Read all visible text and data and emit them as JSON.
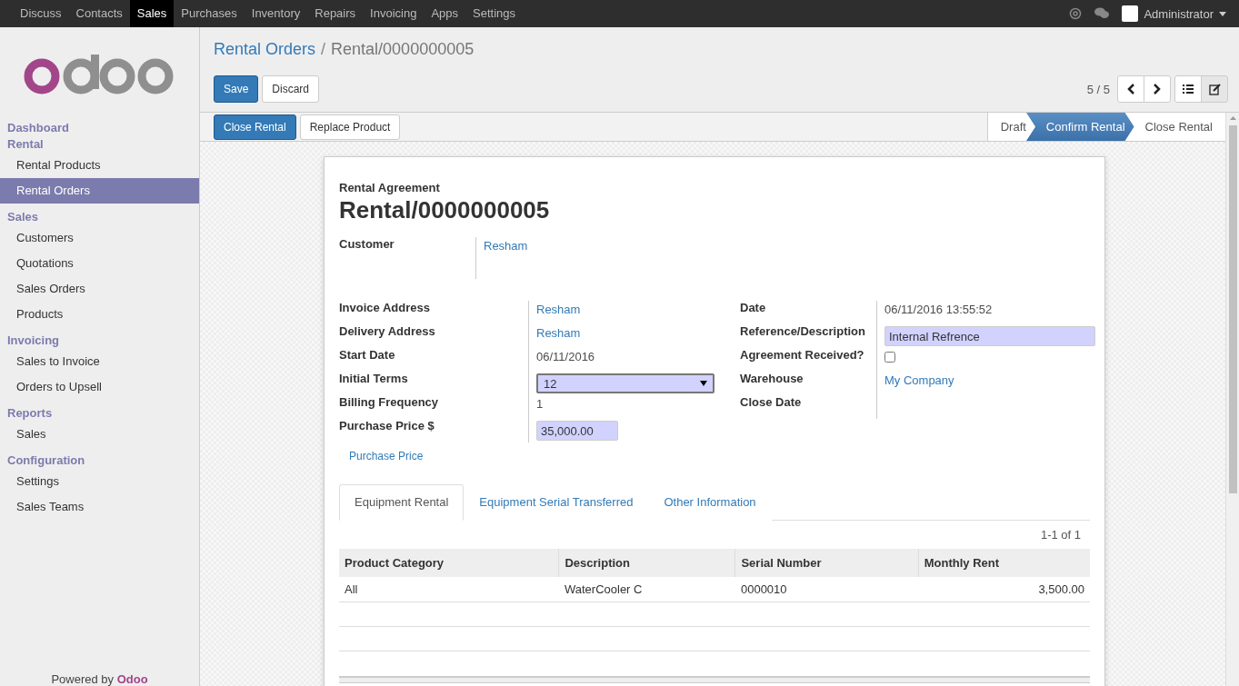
{
  "top_menu": [
    {
      "label": "Discuss",
      "selected": false
    },
    {
      "label": "Contacts",
      "selected": false
    },
    {
      "label": "Sales",
      "selected": true
    },
    {
      "label": "Purchases",
      "selected": false
    },
    {
      "label": "Inventory",
      "selected": false
    },
    {
      "label": "Repairs",
      "selected": false
    },
    {
      "label": "Invoicing",
      "selected": false
    },
    {
      "label": "Apps",
      "selected": false
    },
    {
      "label": "Settings",
      "selected": false
    }
  ],
  "user": {
    "name": "Administrator"
  },
  "sidebar": {
    "sections": [
      {
        "title": "Dashboard"
      },
      {
        "title": "Rental",
        "items": [
          {
            "label": "Rental Products",
            "selected": false
          },
          {
            "label": "Rental Orders",
            "selected": true
          }
        ]
      },
      {
        "title": "Sales",
        "items": [
          {
            "label": "Customers",
            "selected": false
          },
          {
            "label": "Quotations",
            "selected": false
          },
          {
            "label": "Sales Orders",
            "selected": false
          },
          {
            "label": "Products",
            "selected": false
          }
        ]
      },
      {
        "title": "Invoicing",
        "items": [
          {
            "label": "Sales to Invoice",
            "selected": false
          },
          {
            "label": "Orders to Upsell",
            "selected": false
          }
        ]
      },
      {
        "title": "Reports",
        "items": [
          {
            "label": "Sales",
            "selected": false
          }
        ]
      },
      {
        "title": "Configuration",
        "items": [
          {
            "label": "Settings",
            "selected": false
          },
          {
            "label": "Sales Teams",
            "selected": false
          }
        ]
      }
    ],
    "footer": {
      "text": "Powered by",
      "brand": "Odoo"
    }
  },
  "breadcrumb": {
    "parent": "Rental Orders",
    "separator": "/",
    "current": "Rental/0000000005"
  },
  "buttons": [
    {
      "label": "Save",
      "kind": "primary"
    },
    {
      "label": "Discard",
      "kind": "default"
    }
  ],
  "pager": "5 / 5",
  "header_buttons": [
    {
      "label": "Close Rental",
      "kind": "primary"
    },
    {
      "label": "Replace Product",
      "kind": "default"
    }
  ],
  "stages": [
    {
      "label": "Draft",
      "selected": false
    },
    {
      "label": "Confirm Rental",
      "selected": true
    },
    {
      "label": "Close Rental",
      "selected": false
    }
  ],
  "form": {
    "subtitle": "Rental Agreement",
    "title": "Rental/0000000005",
    "customer": {
      "label": "Customer",
      "value": "Resham"
    },
    "left_fields": [
      {
        "label": "Invoice Address",
        "value": "Resham",
        "kind": "link"
      },
      {
        "label": "Delivery Address",
        "value": "Resham",
        "kind": "link"
      },
      {
        "label": "Start Date",
        "value": "06/11/2016",
        "kind": "text"
      },
      {
        "label": "Initial Terms",
        "value": "12",
        "kind": "select"
      },
      {
        "label": "Billing Frequency",
        "value": "1",
        "kind": "text"
      },
      {
        "label": "Purchase Price $",
        "value": "35,000.00",
        "kind": "input"
      }
    ],
    "right_fields": [
      {
        "label": "Date",
        "value": "06/11/2016 13:55:52",
        "kind": "text"
      },
      {
        "label": "Reference/Description",
        "value": "Internal Refrence",
        "kind": "input"
      },
      {
        "label": "Agreement Received?",
        "checked": false,
        "kind": "checkbox"
      },
      {
        "label": "Warehouse",
        "value": "My Company",
        "kind": "link"
      },
      {
        "label": "Close Date",
        "kind": "text"
      }
    ],
    "link_button": "Purchase Price",
    "tabs": [
      {
        "label": "Equipment Rental",
        "selected": true
      },
      {
        "label": "Equipment Serial Transferred",
        "selected": false
      },
      {
        "label": "Other Information",
        "selected": false
      }
    ],
    "table": {
      "pager": "1-1 of 1",
      "columns": [
        "Product Category",
        "Description",
        "Serial Number",
        "Monthly Rent"
      ],
      "rows": [
        [
          "All",
          "WaterCooler C",
          "0000010",
          "3,500.00"
        ]
      ]
    }
  }
}
